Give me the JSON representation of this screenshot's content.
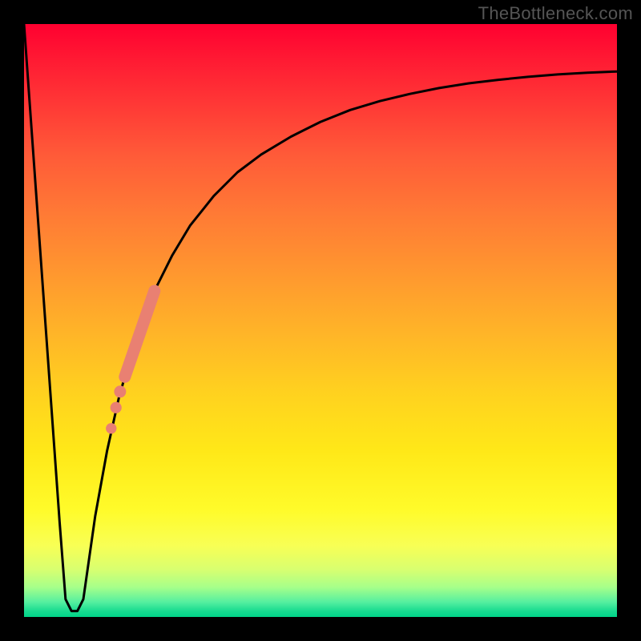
{
  "watermark": "TheBottleneck.com",
  "chart_data": {
    "type": "line",
    "title": "",
    "xlabel": "",
    "ylabel": "",
    "xlim": [
      0,
      100
    ],
    "ylim": [
      0,
      100
    ],
    "grid": false,
    "legend": false,
    "series": [
      {
        "name": "bottleneck-curve",
        "x": [
          0,
          2,
          4,
          6,
          7,
          8,
          9,
          10,
          11,
          12,
          14,
          16,
          18,
          20,
          22,
          25,
          28,
          32,
          36,
          40,
          45,
          50,
          55,
          60,
          65,
          70,
          75,
          80,
          85,
          90,
          95,
          100
        ],
        "y": [
          100,
          72,
          44,
          16,
          3,
          1,
          1,
          3,
          10,
          17,
          28,
          37,
          44,
          50,
          55,
          61,
          66,
          71,
          75,
          78,
          81,
          83.5,
          85.5,
          87,
          88.2,
          89.2,
          90,
          90.6,
          91.1,
          91.5,
          91.8,
          92
        ]
      }
    ],
    "highlight_segment": {
      "name": "salmon-band",
      "color": "#e98072",
      "points": [
        {
          "x": 17.0,
          "y": 40.5
        },
        {
          "x": 22.0,
          "y": 55.0
        }
      ],
      "dots": [
        {
          "x": 16.2,
          "y": 38.0
        },
        {
          "x": 15.5,
          "y": 35.3
        },
        {
          "x": 14.7,
          "y": 31.8
        }
      ]
    },
    "background": {
      "type": "vertical-gradient",
      "meaning": "red=high bottleneck, green=low bottleneck",
      "stops": [
        {
          "pos": 0.0,
          "color": "#ff0030"
        },
        {
          "pos": 0.5,
          "color": "#ffb428"
        },
        {
          "pos": 0.82,
          "color": "#fffb2a"
        },
        {
          "pos": 1.0,
          "color": "#00d488"
        }
      ]
    }
  }
}
